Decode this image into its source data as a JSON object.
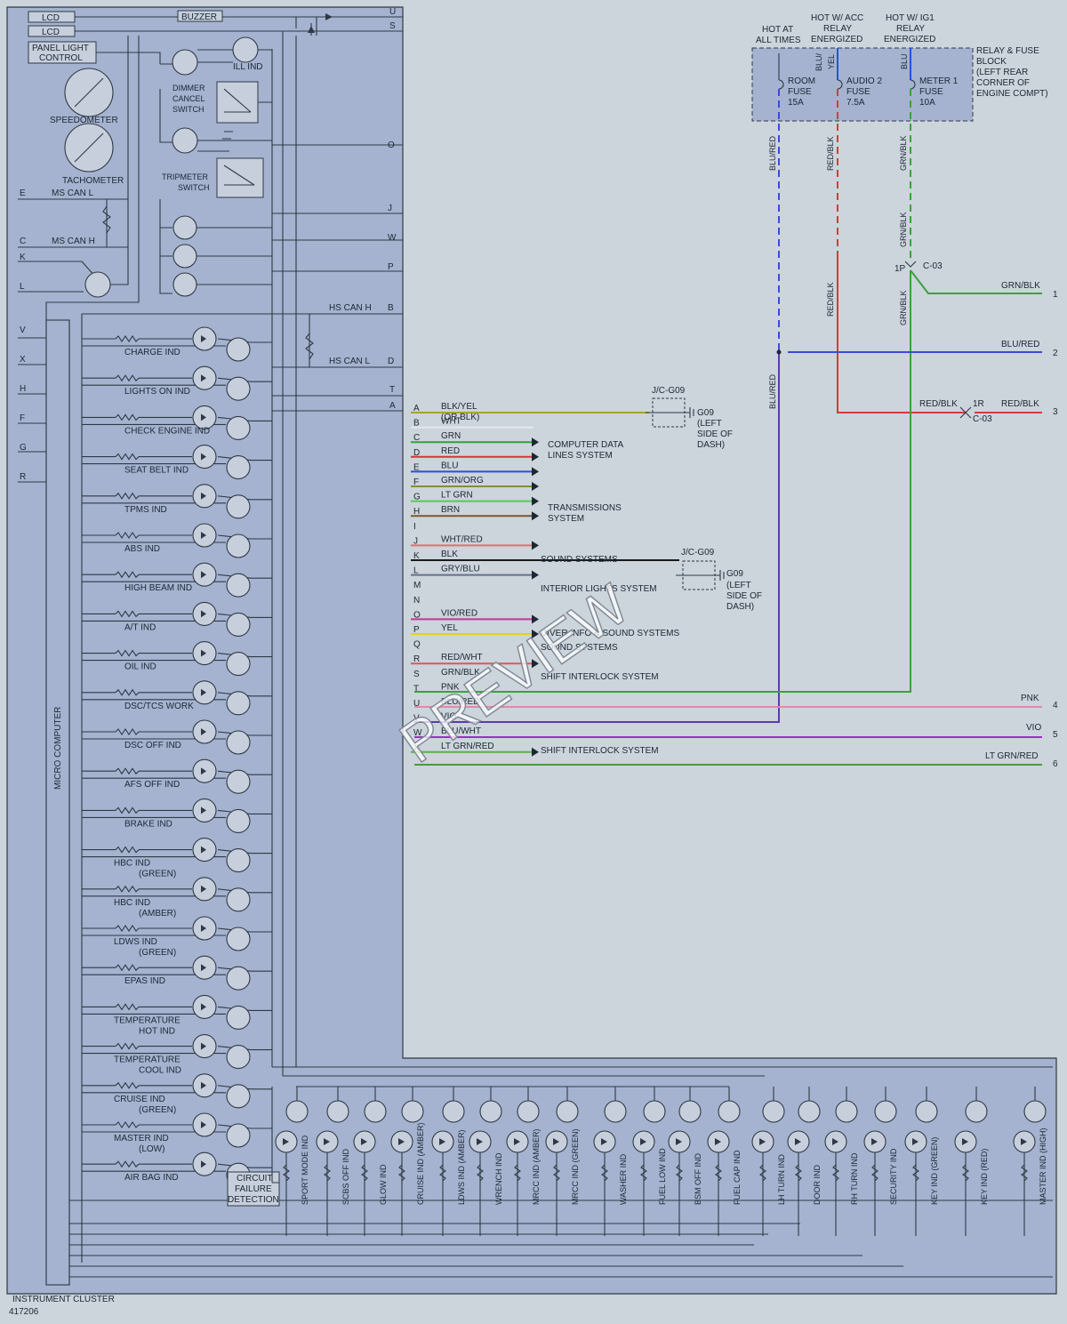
{
  "left_box": {
    "labels": [
      "LCD",
      "LCD",
      "BUZZER",
      "PANEL LIGHT",
      "CONTROL",
      "ILL IND",
      "DIMMER",
      "CANCEL",
      "SWITCH",
      "SPEEDOMETER",
      "TACHOMETER",
      "TRIPMETER",
      "SWITCH",
      "MS CAN L",
      "MS CAN H",
      "HS CAN H",
      "HS CAN L",
      "MICRO COMPUTER"
    ],
    "pins_right": [
      "U",
      "S",
      "O",
      "J",
      "W",
      "P",
      "B",
      "D",
      "T",
      "A"
    ],
    "pins_left": [
      "E",
      "C",
      "K",
      "L",
      "V",
      "X",
      "H",
      "F",
      "G",
      "R"
    ]
  },
  "indicators_left": [
    {
      "text": "CHARGE IND"
    },
    {
      "text": "LIGHTS ON IND"
    },
    {
      "text": "CHECK ENGINE IND"
    },
    {
      "text": "SEAT BELT IND"
    },
    {
      "text": "TPMS IND"
    },
    {
      "text": "ABS IND"
    },
    {
      "text": "HIGH BEAM IND"
    },
    {
      "text": "A/T IND"
    },
    {
      "text": "OIL IND"
    },
    {
      "text": "DSC/TCS WORK"
    },
    {
      "text": "DSC OFF IND"
    },
    {
      "text": "AFS OFF IND"
    },
    {
      "text": "BRAKE IND"
    },
    {
      "text": "HBC IND",
      "sub": "(GREEN)"
    },
    {
      "text": "HBC IND",
      "sub": "(AMBER)"
    },
    {
      "text": "LDWS IND",
      "sub": "(GREEN)"
    },
    {
      "text": "EPAS IND"
    },
    {
      "text": "TEMPERATURE",
      "sub": "HOT IND"
    },
    {
      "text": "TEMPERATURE",
      "sub": "COOL IND"
    },
    {
      "text": "CRUISE IND",
      "sub": "(GREEN)"
    },
    {
      "text": "MASTER IND",
      "sub": "(LOW)"
    },
    {
      "text": "AIR BAG IND"
    }
  ],
  "circuit_failure": [
    "CIRCUIT",
    "FAILURE",
    "DETECTION"
  ],
  "indicators_bottom": [
    "SPORT MODE IND",
    "SCBS OFF IND",
    "GLOW IND",
    "CRUISE IND (AMBER)",
    "LDWS IND (AMBER)",
    "WRENCH IND",
    "MRCC IND (AMBER)",
    "MRCC IND (GREEN)",
    "WASHER IND",
    "FUEL LOW IND",
    "BSM OFF IND",
    "FUEL CAP IND",
    "LH TURN IND",
    "DOOR IND",
    "RH TURN IND",
    "SECURITY IND",
    "KEY IND (GREEN)",
    "KEY IND (RED)",
    "MASTER IND (HIGH)"
  ],
  "connector_pins": [
    {
      "pin": "A",
      "wire": "BLK/YEL",
      "wire2": "(OR BLK)",
      "color": "#a8a22c"
    },
    {
      "pin": "B",
      "wire": "WHT",
      "color": "#e6e8ee"
    },
    {
      "pin": "C",
      "wire": "GRN",
      "color": "#2ca23c"
    },
    {
      "pin": "D",
      "wire": "RED",
      "color": "#d83434"
    },
    {
      "pin": "E",
      "wire": "BLU",
      "color": "#2a4ee0"
    },
    {
      "pin": "F",
      "wire": "GRN/ORG",
      "color": "#8a8a3a"
    },
    {
      "pin": "G",
      "wire": "LT GRN",
      "color": "#58c85a"
    },
    {
      "pin": "H",
      "wire": "BRN",
      "color": "#7a5a2a"
    },
    {
      "pin": "I",
      "wire": "",
      "color": ""
    },
    {
      "pin": "J",
      "wire": "WHT/RED",
      "color": "#e07070"
    },
    {
      "pin": "K",
      "wire": "BLK",
      "color": "#1a1a1a"
    },
    {
      "pin": "L",
      "wire": "GRY/BLU",
      "color": "#66708a"
    },
    {
      "pin": "M",
      "wire": "",
      "color": ""
    },
    {
      "pin": "N",
      "wire": "",
      "color": ""
    },
    {
      "pin": "O",
      "wire": "VIO/RED",
      "color": "#c2379a"
    },
    {
      "pin": "P",
      "wire": "YEL",
      "color": "#e6d11a"
    },
    {
      "pin": "Q",
      "wire": "",
      "color": ""
    },
    {
      "pin": "R",
      "wire": "RED/WHT",
      "color": "#d85a5a"
    },
    {
      "pin": "S",
      "wire": "GRN/BLK",
      "color": "#3e9a3e"
    },
    {
      "pin": "T",
      "wire": "PNK",
      "color": "#e38aa0"
    },
    {
      "pin": "U",
      "wire": "BLU/RED",
      "color": "#5b3ab2"
    },
    {
      "pin": "V",
      "wire": "VIO",
      "color": "#9a30d0"
    },
    {
      "pin": "W",
      "wire": "BLU/WHT",
      "color": "#4a64c8"
    },
    {
      "pin": "X",
      "wire": "LT GRN/RED",
      "color": "#5ab04a"
    }
  ],
  "systems": [
    "COMPUTER DATA",
    "LINES SYSTEM",
    "TRANSMISSIONS",
    "SYSTEM",
    "SOUND SYSTEMS",
    "INTERIOR LIGHTS SYSTEM",
    "DIVER INFO & SOUND SYSTEMS",
    "SOUND SYSTEMS",
    "SHIFT INTERLOCK SYSTEM",
    "SHIFT INTERLOCK SYSTEM"
  ],
  "ground_labels": {
    "jc1": "J/C-G09",
    "g1": [
      "G09",
      "(LEFT",
      "SIDE OF",
      "DASH)"
    ],
    "jc2": "J/C-G09",
    "g2": [
      "G09",
      "(LEFT",
      "SIDE OF",
      "DASH)"
    ]
  },
  "power_headers": [
    "HOT AT",
    "ALL TIMES",
    "HOT W/ ACC",
    "RELAY",
    "ENERGIZED",
    "HOT W/ IG1",
    "RELAY",
    "ENERGIZED"
  ],
  "fuse_block": {
    "fuses": [
      [
        "ROOM",
        "FUSE",
        "15A"
      ],
      [
        "AUDIO 2",
        "FUSE",
        "7.5A"
      ],
      [
        "METER 1",
        "FUSE",
        "10A"
      ]
    ],
    "label": [
      "RELAY & FUSE",
      "BLOCK",
      "(LEFT REAR",
      "CORNER OF",
      "ENGINE COMPT)"
    ],
    "wire_tags": [
      "BLU/",
      "YEL",
      "BLU"
    ]
  },
  "right_wires": {
    "vertical": [
      "BLU/RED",
      "RED/BLK",
      "GRN/BLK",
      "GRN/BLK",
      "RED/BLK",
      "GRN/BLK",
      "BLU/RED"
    ],
    "c03_top": {
      "pin": "1P",
      "name": "C-03"
    },
    "c03_mid": {
      "pin": "1R",
      "name": "C-03"
    },
    "outputs": [
      {
        "num": "1",
        "label": "GRN/BLK"
      },
      {
        "num": "2",
        "label": "BLU/RED"
      },
      {
        "num": "3",
        "label": "RED/BLK",
        "label2": "RED/BLK"
      },
      {
        "num": "4",
        "label": "PNK"
      },
      {
        "num": "5",
        "label": "VIO"
      },
      {
        "num": "6",
        "label": "LT GRN/RED"
      }
    ]
  },
  "footer": {
    "title": "INSTRUMENT CLUSTER",
    "code": "417206"
  },
  "watermark": "PREVIEW",
  "colors": {
    "box": "#a5b3d0",
    "background": "#ccd4dc",
    "blu_red": "#3c4ad8",
    "red_blk": "#d83a3a",
    "grn_blk": "#3ea03e",
    "vio": "#a02cc8",
    "pnk": "#e28aa4",
    "lt_grn_red": "#4a9a3a"
  }
}
